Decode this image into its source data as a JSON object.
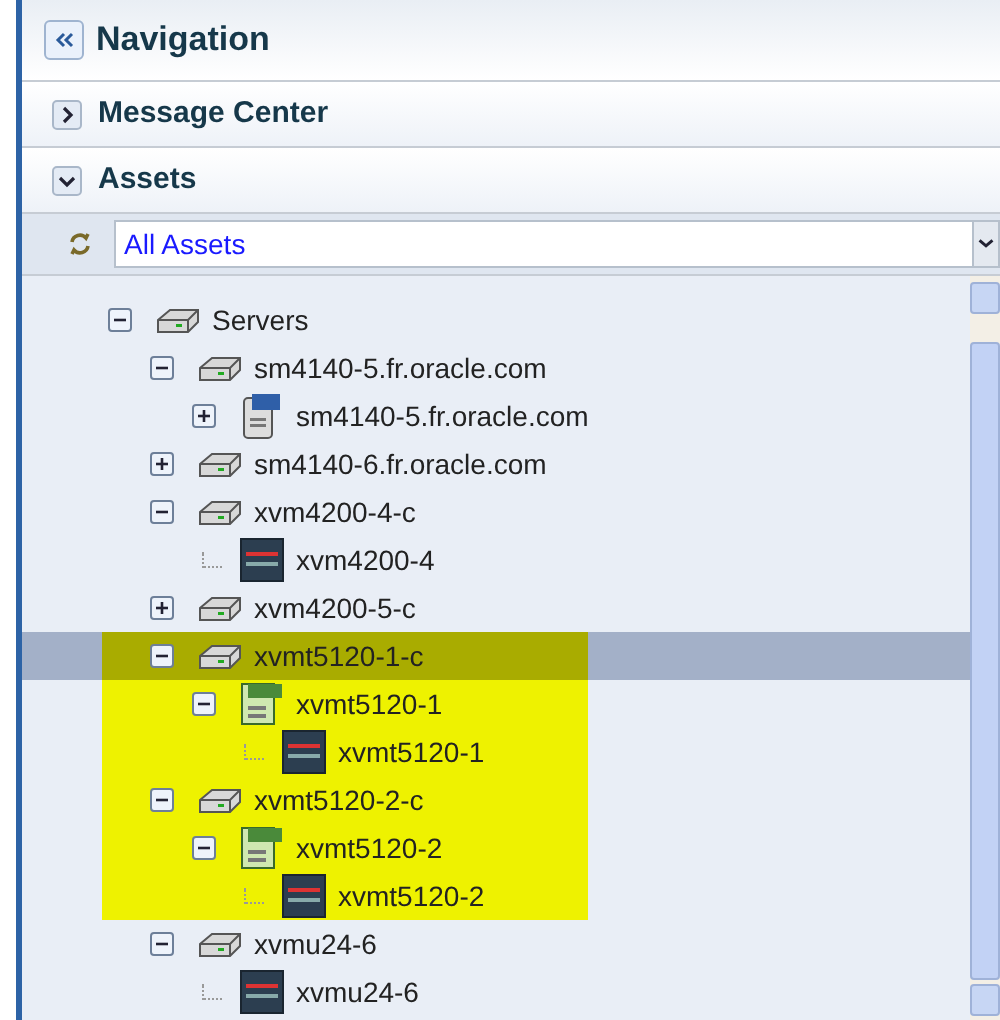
{
  "header": {
    "title": "Navigation"
  },
  "panels": [
    {
      "title": "Message Center",
      "expanded": false
    },
    {
      "title": "Assets",
      "expanded": true
    }
  ],
  "filter": {
    "value": "All Assets"
  },
  "tree": [
    {
      "label": "Servers",
      "kind": "server",
      "expanded": true,
      "selected": false,
      "highlighted": false,
      "children": [
        {
          "label": "sm4140-5.fr.oracle.com",
          "kind": "server",
          "expanded": true,
          "selected": false,
          "highlighted": false,
          "children": [
            {
              "label": "sm4140-5.fr.oracle.com",
              "kind": "x86",
              "expanded": false,
              "selected": false,
              "highlighted": false
            }
          ]
        },
        {
          "label": "sm4140-6.fr.oracle.com",
          "kind": "server",
          "expanded": false,
          "selected": false,
          "highlighted": false
        },
        {
          "label": "xvm4200-4-c",
          "kind": "server",
          "expanded": true,
          "selected": false,
          "highlighted": false,
          "children": [
            {
              "label": "xvm4200-4",
              "kind": "domain",
              "selected": false,
              "highlighted": false
            }
          ]
        },
        {
          "label": "xvm4200-5-c",
          "kind": "server",
          "expanded": false,
          "selected": false,
          "highlighted": false
        },
        {
          "label": "xvmt5120-1-c",
          "kind": "server",
          "expanded": true,
          "selected": true,
          "highlighted": true,
          "children": [
            {
              "label": "xvmt5120-1",
              "kind": "sparc",
              "expanded": true,
              "selected": false,
              "highlighted": true,
              "children": [
                {
                  "label": "xvmt5120-1",
                  "kind": "domain",
                  "selected": false,
                  "highlighted": true
                }
              ]
            }
          ]
        },
        {
          "label": "xvmt5120-2-c",
          "kind": "server",
          "expanded": true,
          "selected": false,
          "highlighted": true,
          "children": [
            {
              "label": "xvmt5120-2",
              "kind": "sparc",
              "expanded": true,
              "selected": false,
              "highlighted": true,
              "children": [
                {
                  "label": "xvmt5120-2",
                  "kind": "domain",
                  "selected": false,
                  "highlighted": true
                }
              ]
            }
          ]
        },
        {
          "label": "xvmu24-6",
          "kind": "server",
          "expanded": true,
          "selected": false,
          "highlighted": false,
          "children": [
            {
              "label": "xvmu24-6",
              "kind": "domain",
              "selected": false,
              "highlighted": false
            }
          ]
        }
      ]
    }
  ]
}
